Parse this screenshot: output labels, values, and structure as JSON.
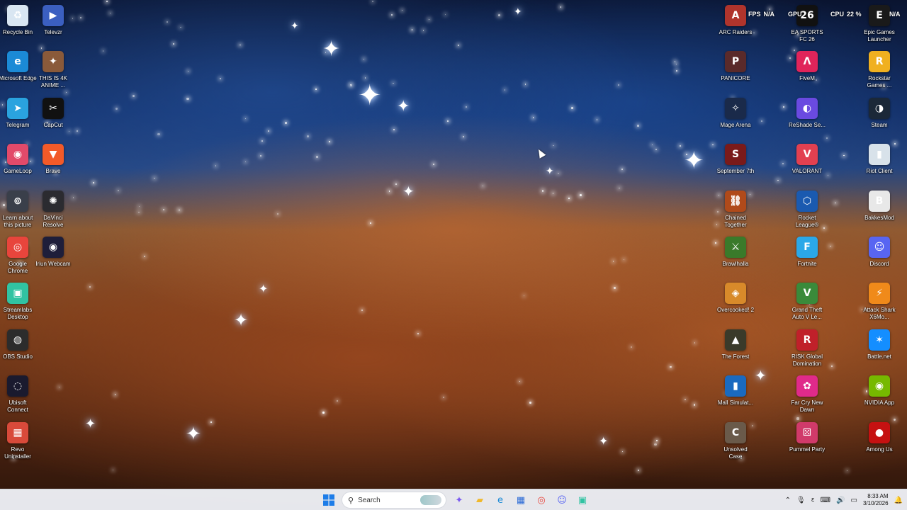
{
  "left_col1": [
    {
      "label": "Recycle Bin",
      "icon": "recycle-bin-icon",
      "bg": "#d9e6f2",
      "glyph": "♻"
    },
    {
      "label": "Microsoft Edge",
      "icon": "edge-icon",
      "bg": "#1b8ad6",
      "glyph": "e"
    },
    {
      "label": "Telegram",
      "icon": "telegram-icon",
      "bg": "#2aa3df",
      "glyph": "➤"
    },
    {
      "label": "GameLoop",
      "icon": "gameloop-icon",
      "bg": "#e24a6a",
      "glyph": "◉"
    },
    {
      "label": "Learn about this picture",
      "icon": "learn-about-picture-icon",
      "bg": "#3a3f4a",
      "glyph": "⊚"
    },
    {
      "label": "Google Chrome",
      "icon": "chrome-icon",
      "bg": "#e8453c",
      "glyph": "◎"
    },
    {
      "label": "Streamlabs Desktop",
      "icon": "streamlabs-icon",
      "bg": "#31c3a2",
      "glyph": "▣"
    },
    {
      "label": "OBS Studio",
      "icon": "obs-icon",
      "bg": "#2c2c2c",
      "glyph": "◍"
    },
    {
      "label": "Ubisoft Connect",
      "icon": "ubisoft-icon",
      "bg": "#1a1a2e",
      "glyph": "◌"
    },
    {
      "label": "Revo Uninstaller",
      "icon": "revo-uninstaller-icon",
      "bg": "#d84a3a",
      "glyph": "▦"
    }
  ],
  "left_col2": [
    {
      "label": "Televzr",
      "icon": "televzr-icon",
      "bg": "#3b5fc0",
      "glyph": "▶"
    },
    {
      "label": "THIS IS 4K ANIME ...",
      "icon": "anime-video-icon",
      "bg": "#8a5a3a",
      "glyph": "✦"
    },
    {
      "label": "CapCut",
      "icon": "capcut-icon",
      "bg": "#111111",
      "glyph": "✂"
    },
    {
      "label": "Brave",
      "icon": "brave-icon",
      "bg": "#f25a29",
      "glyph": "▼"
    },
    {
      "label": "DaVinci Resolve",
      "icon": "davinci-resolve-icon",
      "bg": "#2b2b30",
      "glyph": "✺"
    },
    {
      "label": "Iriun Webcam",
      "icon": "iriun-webcam-icon",
      "bg": "#1e1e3a",
      "glyph": "◉"
    }
  ],
  "right_col1": [
    {
      "label": "ARC Raiders",
      "icon": "arc-raiders-icon",
      "bg": "#b0342c",
      "glyph": "A"
    },
    {
      "label": "PANICORE",
      "icon": "panicore-icon",
      "bg": "#5a2a2a",
      "glyph": "P"
    },
    {
      "label": "Mage Arena",
      "icon": "mage-arena-icon",
      "bg": "#1a2a4a",
      "glyph": "✧"
    },
    {
      "label": "September 7th",
      "icon": "september-7th-icon",
      "bg": "#7a1a1a",
      "glyph": "S"
    },
    {
      "label": "Chained Together",
      "icon": "chained-together-icon",
      "bg": "#b04a1a",
      "glyph": "⛓"
    },
    {
      "label": "Brawlhalla",
      "icon": "brawlhalla-icon",
      "bg": "#3a7a2a",
      "glyph": "⚔"
    },
    {
      "label": "Overcooked! 2",
      "icon": "overcooked-icon",
      "bg": "#d88a2a",
      "glyph": "◈"
    },
    {
      "label": "The Forest",
      "icon": "the-forest-icon",
      "bg": "#3a3a2a",
      "glyph": "▲"
    },
    {
      "label": "Mall Simulat...",
      "icon": "mall-simulator-icon",
      "bg": "#1a6ac0",
      "glyph": "▮"
    },
    {
      "label": "Unsolved Case",
      "icon": "unsolved-case-icon",
      "bg": "#6a5a4a",
      "glyph": "C"
    }
  ],
  "right_col2": [
    {
      "label": "EA SPORTS FC 26",
      "icon": "ea-sports-fc-icon",
      "bg": "#111111",
      "glyph": "26"
    },
    {
      "label": "FiveM",
      "icon": "fivem-icon",
      "bg": "#e0245a",
      "glyph": "Λ"
    },
    {
      "label": "ReShade Se...",
      "icon": "reshade-icon",
      "bg": "#6a4ae0",
      "glyph": "◐"
    },
    {
      "label": "VALORANT",
      "icon": "valorant-icon",
      "bg": "#e24050",
      "glyph": "V"
    },
    {
      "label": "Rocket League®",
      "icon": "rocket-league-icon",
      "bg": "#1a5ab0",
      "glyph": "⬡"
    },
    {
      "label": "Fortnite",
      "icon": "fortnite-icon",
      "bg": "#2aa8e8",
      "glyph": "F"
    },
    {
      "label": "Grand Theft Auto V Le...",
      "icon": "gta-v-icon",
      "bg": "#3a8a3a",
      "glyph": "V"
    },
    {
      "label": "RISK Global Domination",
      "icon": "risk-icon",
      "bg": "#c0202a",
      "glyph": "R"
    },
    {
      "label": "Far Cry New Dawn",
      "icon": "far-cry-icon",
      "bg": "#e02a8a",
      "glyph": "✿"
    },
    {
      "label": "Pummel Party",
      "icon": "pummel-party-icon",
      "bg": "#d03a6a",
      "glyph": "⚄"
    }
  ],
  "right_col3": [
    {
      "label": "Epic Games Launcher",
      "icon": "epic-games-icon",
      "bg": "#1a1a1a",
      "glyph": "E"
    },
    {
      "label": "Rockstar Games ...",
      "icon": "rockstar-icon",
      "bg": "#f0b020",
      "glyph": "R"
    },
    {
      "label": "Steam",
      "icon": "steam-icon",
      "bg": "#1b2838",
      "glyph": "◑"
    },
    {
      "label": "Riot Client",
      "icon": "riot-client-icon",
      "bg": "#d8e2ea",
      "glyph": "▮"
    },
    {
      "label": "BakkesMod",
      "icon": "bakkesmod-icon",
      "bg": "#e8e8e8",
      "glyph": "B"
    },
    {
      "label": "Discord",
      "icon": "discord-icon",
      "bg": "#5865f2",
      "glyph": "☺"
    },
    {
      "label": "Attack Shark X6Mo...",
      "icon": "attack-shark-icon",
      "bg": "#f08a1a",
      "glyph": "⚡"
    },
    {
      "label": "Battle.net",
      "icon": "battlenet-icon",
      "bg": "#148eff",
      "glyph": "✶"
    },
    {
      "label": "NVIDIA App",
      "icon": "nvidia-icon",
      "bg": "#76b900",
      "glyph": "◉"
    },
    {
      "label": "Among Us",
      "icon": "among-us-icon",
      "bg": "#c51111",
      "glyph": "●"
    }
  ],
  "overlay": {
    "fps_label": "FPS",
    "fps_value": "N/A",
    "gpu_label": "GPU",
    "gpu_value": "",
    "cpu_label": "CPU",
    "cpu_value": "22 %",
    "extra_value": "N/A"
  },
  "taskbar": {
    "search_placeholder": "Search",
    "apps": [
      {
        "name": "copilot-icon",
        "glyph": "✦",
        "color": "#7a5af0"
      },
      {
        "name": "file-explorer-icon",
        "glyph": "▰",
        "color": "#f0b82a"
      },
      {
        "name": "edge-taskbar-icon",
        "glyph": "e",
        "color": "#1b8ad6"
      },
      {
        "name": "store-icon",
        "glyph": "▦",
        "color": "#2a6ad6"
      },
      {
        "name": "chrome-taskbar-icon",
        "glyph": "◎",
        "color": "#e8453c"
      },
      {
        "name": "discord-taskbar-icon",
        "glyph": "☺",
        "color": "#5865f2"
      },
      {
        "name": "streamlabs-taskbar-icon",
        "glyph": "▣",
        "color": "#31c3a2"
      }
    ],
    "time": "8:33 AM",
    "date": "3/10/2026"
  }
}
